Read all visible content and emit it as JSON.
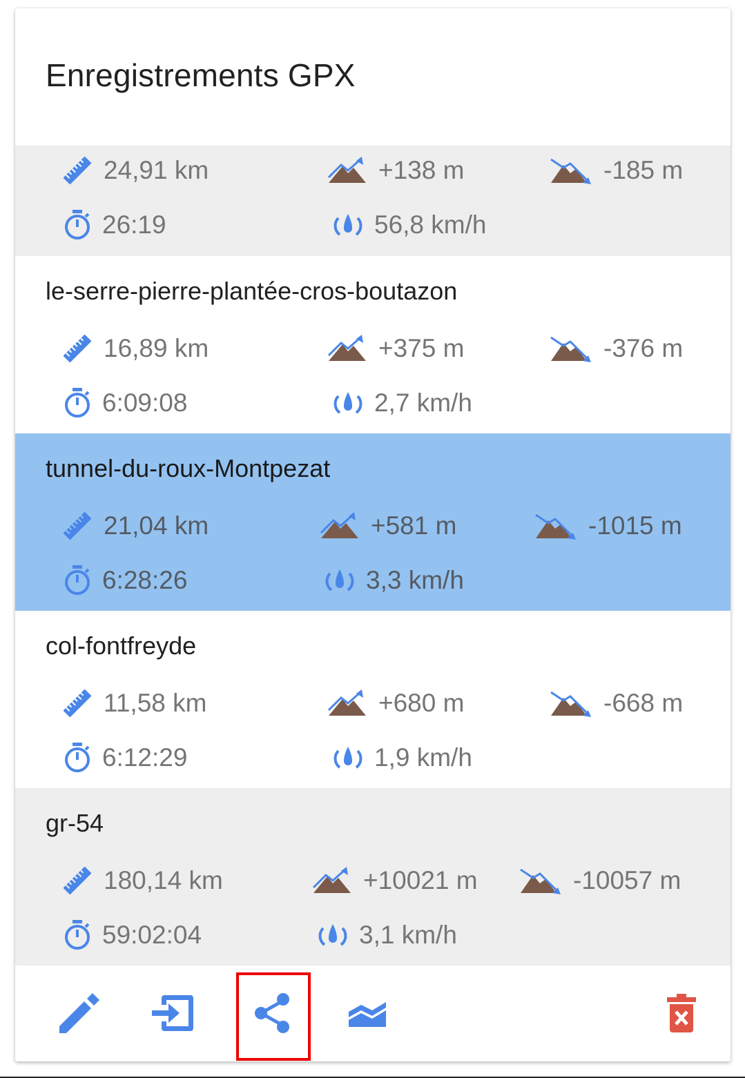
{
  "dialog": {
    "title": "Enregistrements GPX"
  },
  "colors": {
    "accent": "#4a86e8",
    "selected_row": "#93c2f1",
    "alt_row": "#eeeeee",
    "mountain": "#7a5a4a",
    "delete": "#e05545",
    "highlight_box": "#ee0000"
  },
  "records": [
    {
      "name": "",
      "distance": "24,91 km",
      "ascent": "+138 m",
      "descent": "-185 m",
      "duration": "26:19",
      "speed": "56,8 km/h",
      "selected": false
    },
    {
      "name": "le-serre-pierre-plantée-cros-boutazon",
      "distance": "16,89 km",
      "ascent": "+375 m",
      "descent": "-376 m",
      "duration": "6:09:08",
      "speed": "2,7 km/h",
      "selected": false
    },
    {
      "name": "tunnel-du-roux-Montpezat",
      "distance": "21,04 km",
      "ascent": "+581 m",
      "descent": "-1015 m",
      "duration": "6:28:26",
      "speed": "3,3 km/h",
      "selected": true
    },
    {
      "name": "col-fontfreyde",
      "distance": "11,58 km",
      "ascent": "+680 m",
      "descent": "-668 m",
      "duration": "6:12:29",
      "speed": "1,9 km/h",
      "selected": false
    },
    {
      "name": "gr-54",
      "distance": "180,14 km",
      "ascent": "+10021 m",
      "descent": "-10057 m",
      "duration": "59:02:04",
      "speed": "3,1 km/h",
      "selected": false
    }
  ],
  "toolbar": {
    "buttons": [
      {
        "icon": "pencil-icon"
      },
      {
        "icon": "import-icon"
      },
      {
        "icon": "share-icon",
        "highlighted": true
      },
      {
        "icon": "elevation-chart-icon"
      },
      {
        "icon": "delete-icon"
      }
    ]
  }
}
